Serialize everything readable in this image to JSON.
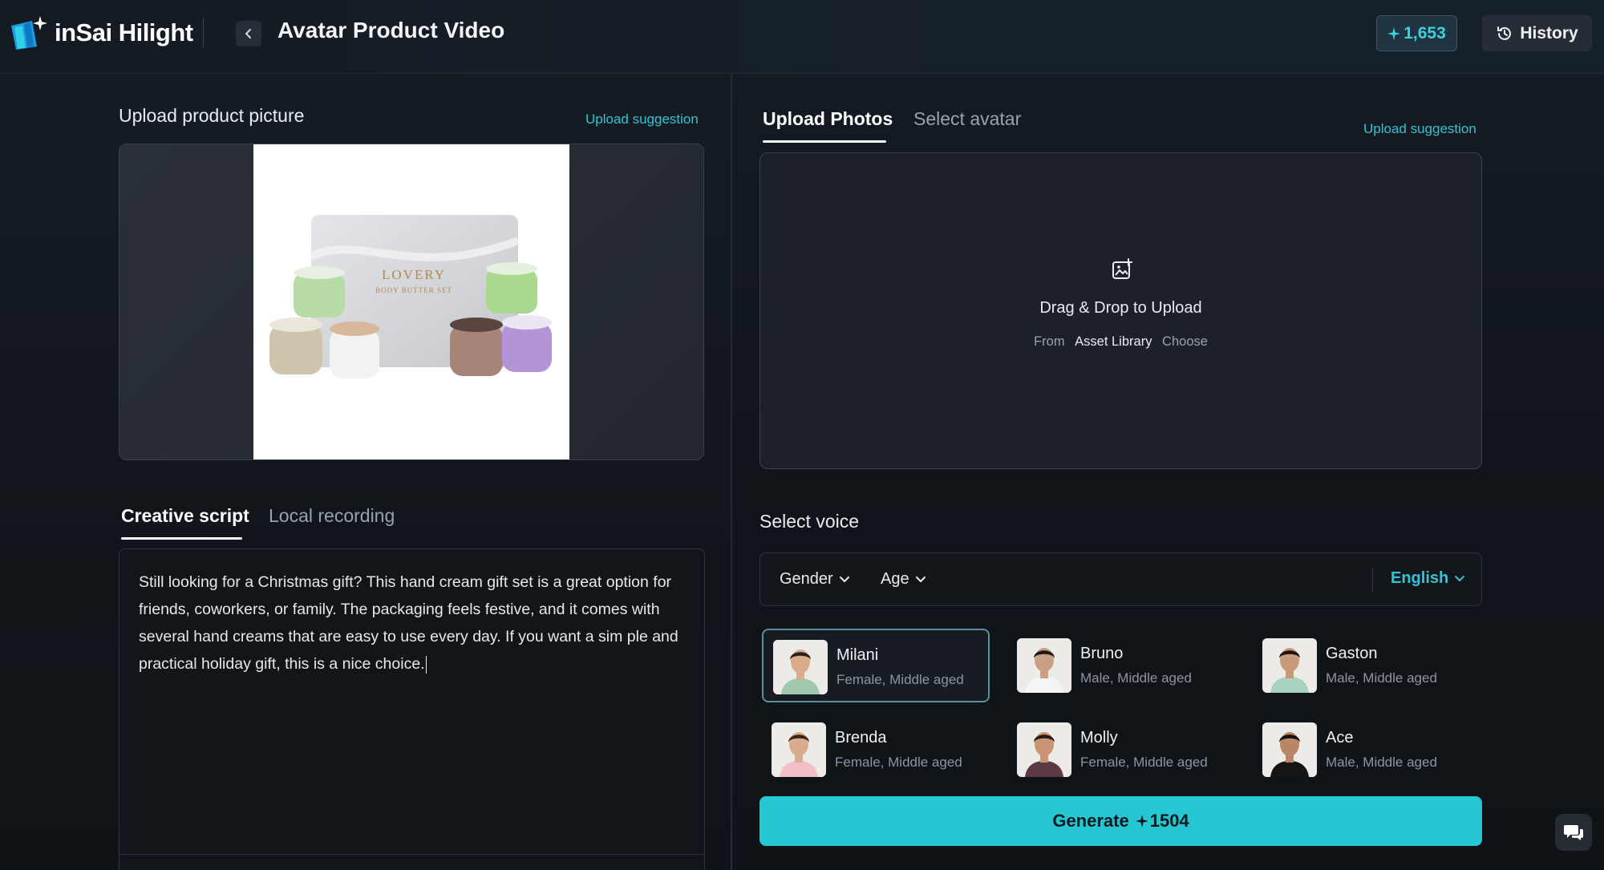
{
  "app": {
    "name": "inSai Hilight"
  },
  "header": {
    "title": "Avatar Product Video",
    "credits": "1,653",
    "history_label": "History"
  },
  "left": {
    "upload_label": "Upload product picture",
    "upload_suggestion": "Upload suggestion",
    "product_image": {
      "brand": "LOVERY",
      "subtitle": "BODY BUTTER SET"
    },
    "tabs": [
      {
        "label": "Creative script",
        "active": true
      },
      {
        "label": "Local recording",
        "active": false
      }
    ],
    "script": "Still looking for a Christmas gift? This hand cream gift set is a great option for friends, coworkers, or family. The packaging feels festive, and it comes with several hand creams that are easy to use every day. If you want a sim ple and practical holiday gift, this is a nice choice."
  },
  "right": {
    "tabs": [
      {
        "label": "Upload Photos",
        "active": true
      },
      {
        "label": "Select avatar",
        "active": false
      }
    ],
    "upload_suggestion": "Upload suggestion",
    "upload": {
      "title": "Drag & Drop to Upload",
      "from": "From",
      "asset_library": "Asset Library",
      "choose": "Choose"
    },
    "voice": {
      "label": "Select voice",
      "filters": {
        "gender": "Gender",
        "age": "Age",
        "language": "English"
      },
      "items": [
        {
          "name": "Milani",
          "desc": "Female, Middle aged",
          "selected": true,
          "shirt": "#9ec9ae",
          "hair": "#2b2019",
          "skin": "#d9ad8c"
        },
        {
          "name": "Bruno",
          "desc": "Male, Middle aged",
          "selected": false,
          "shirt": "#f4f4f4",
          "hair": "#1f1915",
          "skin": "#caa084"
        },
        {
          "name": "Gaston",
          "desc": "Male, Middle aged",
          "selected": false,
          "shirt": "#a7d3be",
          "hair": "#1c1714",
          "skin": "#c89a7a"
        },
        {
          "name": "Brenda",
          "desc": "Female, Middle aged",
          "selected": false,
          "shirt": "#f2bfc8",
          "hair": "#3a2718",
          "skin": "#d8ac8c"
        },
        {
          "name": "Molly",
          "desc": "Female, Middle aged",
          "selected": false,
          "shirt": "#5a3a44",
          "hair": "#2a1c14",
          "skin": "#c99474"
        },
        {
          "name": "Ace",
          "desc": "Male, Middle aged",
          "selected": false,
          "shirt": "#151515",
          "hair": "#15110f",
          "skin": "#b98668"
        }
      ]
    },
    "generate": {
      "label": "Generate",
      "cost": "1504"
    }
  },
  "colors": {
    "accent": "#26c6d3",
    "link": "#35c3d2",
    "background": "#0f1216"
  }
}
